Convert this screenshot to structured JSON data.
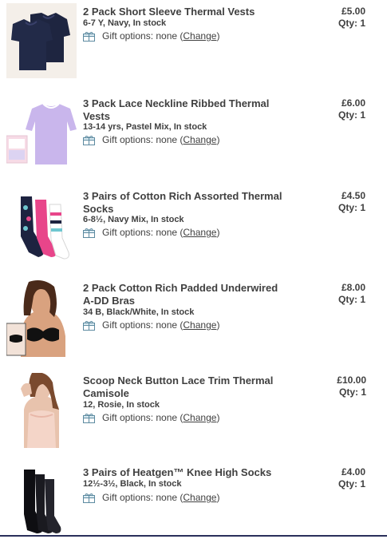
{
  "items": [
    {
      "title_lines": [
        "2 Pack Short Sleeve Thermal Vests"
      ],
      "details": "6-7 Y, Navy, In stock",
      "price": "£5.00",
      "qty": "Qty: 1",
      "gift_prefix": "Gift options: none (",
      "gift_link": "Change",
      "gift_suffix": ")",
      "image": "navy-thermal-vests"
    },
    {
      "title_lines": [
        "3 Pack Lace Neckline Ribbed Thermal",
        "Vests"
      ],
      "details": "13-14 yrs, Pastel Mix, In stock",
      "price": "£6.00",
      "qty": "Qty: 1",
      "gift_prefix": "Gift options: none (",
      "gift_link": "Change",
      "gift_suffix": ")",
      "image": "pastel-thermal-vests"
    },
    {
      "title_lines": [
        "3 Pairs of Cotton Rich Assorted Thermal",
        "Socks"
      ],
      "details": "6-8½, Navy Mix, In stock",
      "price": "£4.50",
      "qty": "Qty: 1",
      "gift_prefix": "Gift options: none (",
      "gift_link": "Change",
      "gift_suffix": ")",
      "image": "assorted-thermal-socks"
    },
    {
      "title_lines": [
        "2 Pack Cotton Rich Padded Underwired",
        "A-DD Bras"
      ],
      "details": "34 B, Black/White, In stock",
      "price": "£8.00",
      "qty": "Qty: 1",
      "gift_prefix": "Gift options: none (",
      "gift_link": "Change",
      "gift_suffix": ")",
      "image": "padded-bras"
    },
    {
      "title_lines": [
        "Scoop Neck Button Lace Trim Thermal",
        "Camisole"
      ],
      "details": "12, Rosie, In stock",
      "price": "£10.00",
      "qty": "Qty: 1",
      "gift_prefix": "Gift options: none (",
      "gift_link": "Change",
      "gift_suffix": ")",
      "image": "thermal-camisole"
    },
    {
      "title_lines": [
        "3 Pairs of Heatgen™ Knee High Socks"
      ],
      "details": "12½-3½, Black, In stock",
      "price": "£4.00",
      "qty": "Qty: 1",
      "gift_prefix": "Gift options: none (",
      "gift_link": "Change",
      "gift_suffix": ")",
      "image": "black-knee-socks"
    }
  ],
  "colors": {
    "text": "#404040",
    "bottom_rule": "#2a2f5b"
  }
}
